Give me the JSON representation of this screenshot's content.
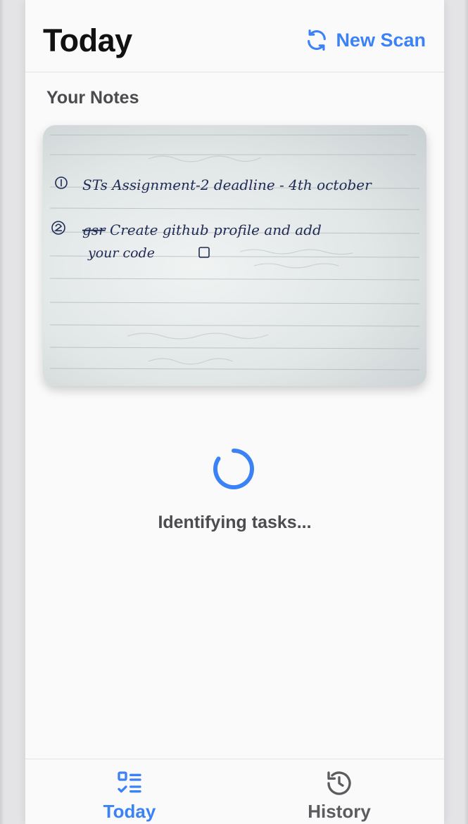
{
  "header": {
    "title": "Today",
    "new_scan_label": "New Scan",
    "new_scan_icon": "refresh-icon"
  },
  "notes_section": {
    "title": "Your Notes",
    "image": {
      "kind": "photo of handwritten notebook page",
      "lines": [
        "STs Assignment-2 deadline - 4th october",
        "Create github profile and add your code"
      ]
    }
  },
  "loading": {
    "text": "Identifying tasks..."
  },
  "bottom_nav": {
    "items": [
      {
        "label": "Today",
        "icon": "checklist-icon",
        "active": true
      },
      {
        "label": "History",
        "icon": "history-icon",
        "active": false
      }
    ]
  },
  "colors": {
    "accent": "#3b82f6",
    "title": "#111111",
    "muted_text": "#4a4a4f",
    "background": "#fafafa",
    "inactive_nav": "#5b5b60"
  }
}
